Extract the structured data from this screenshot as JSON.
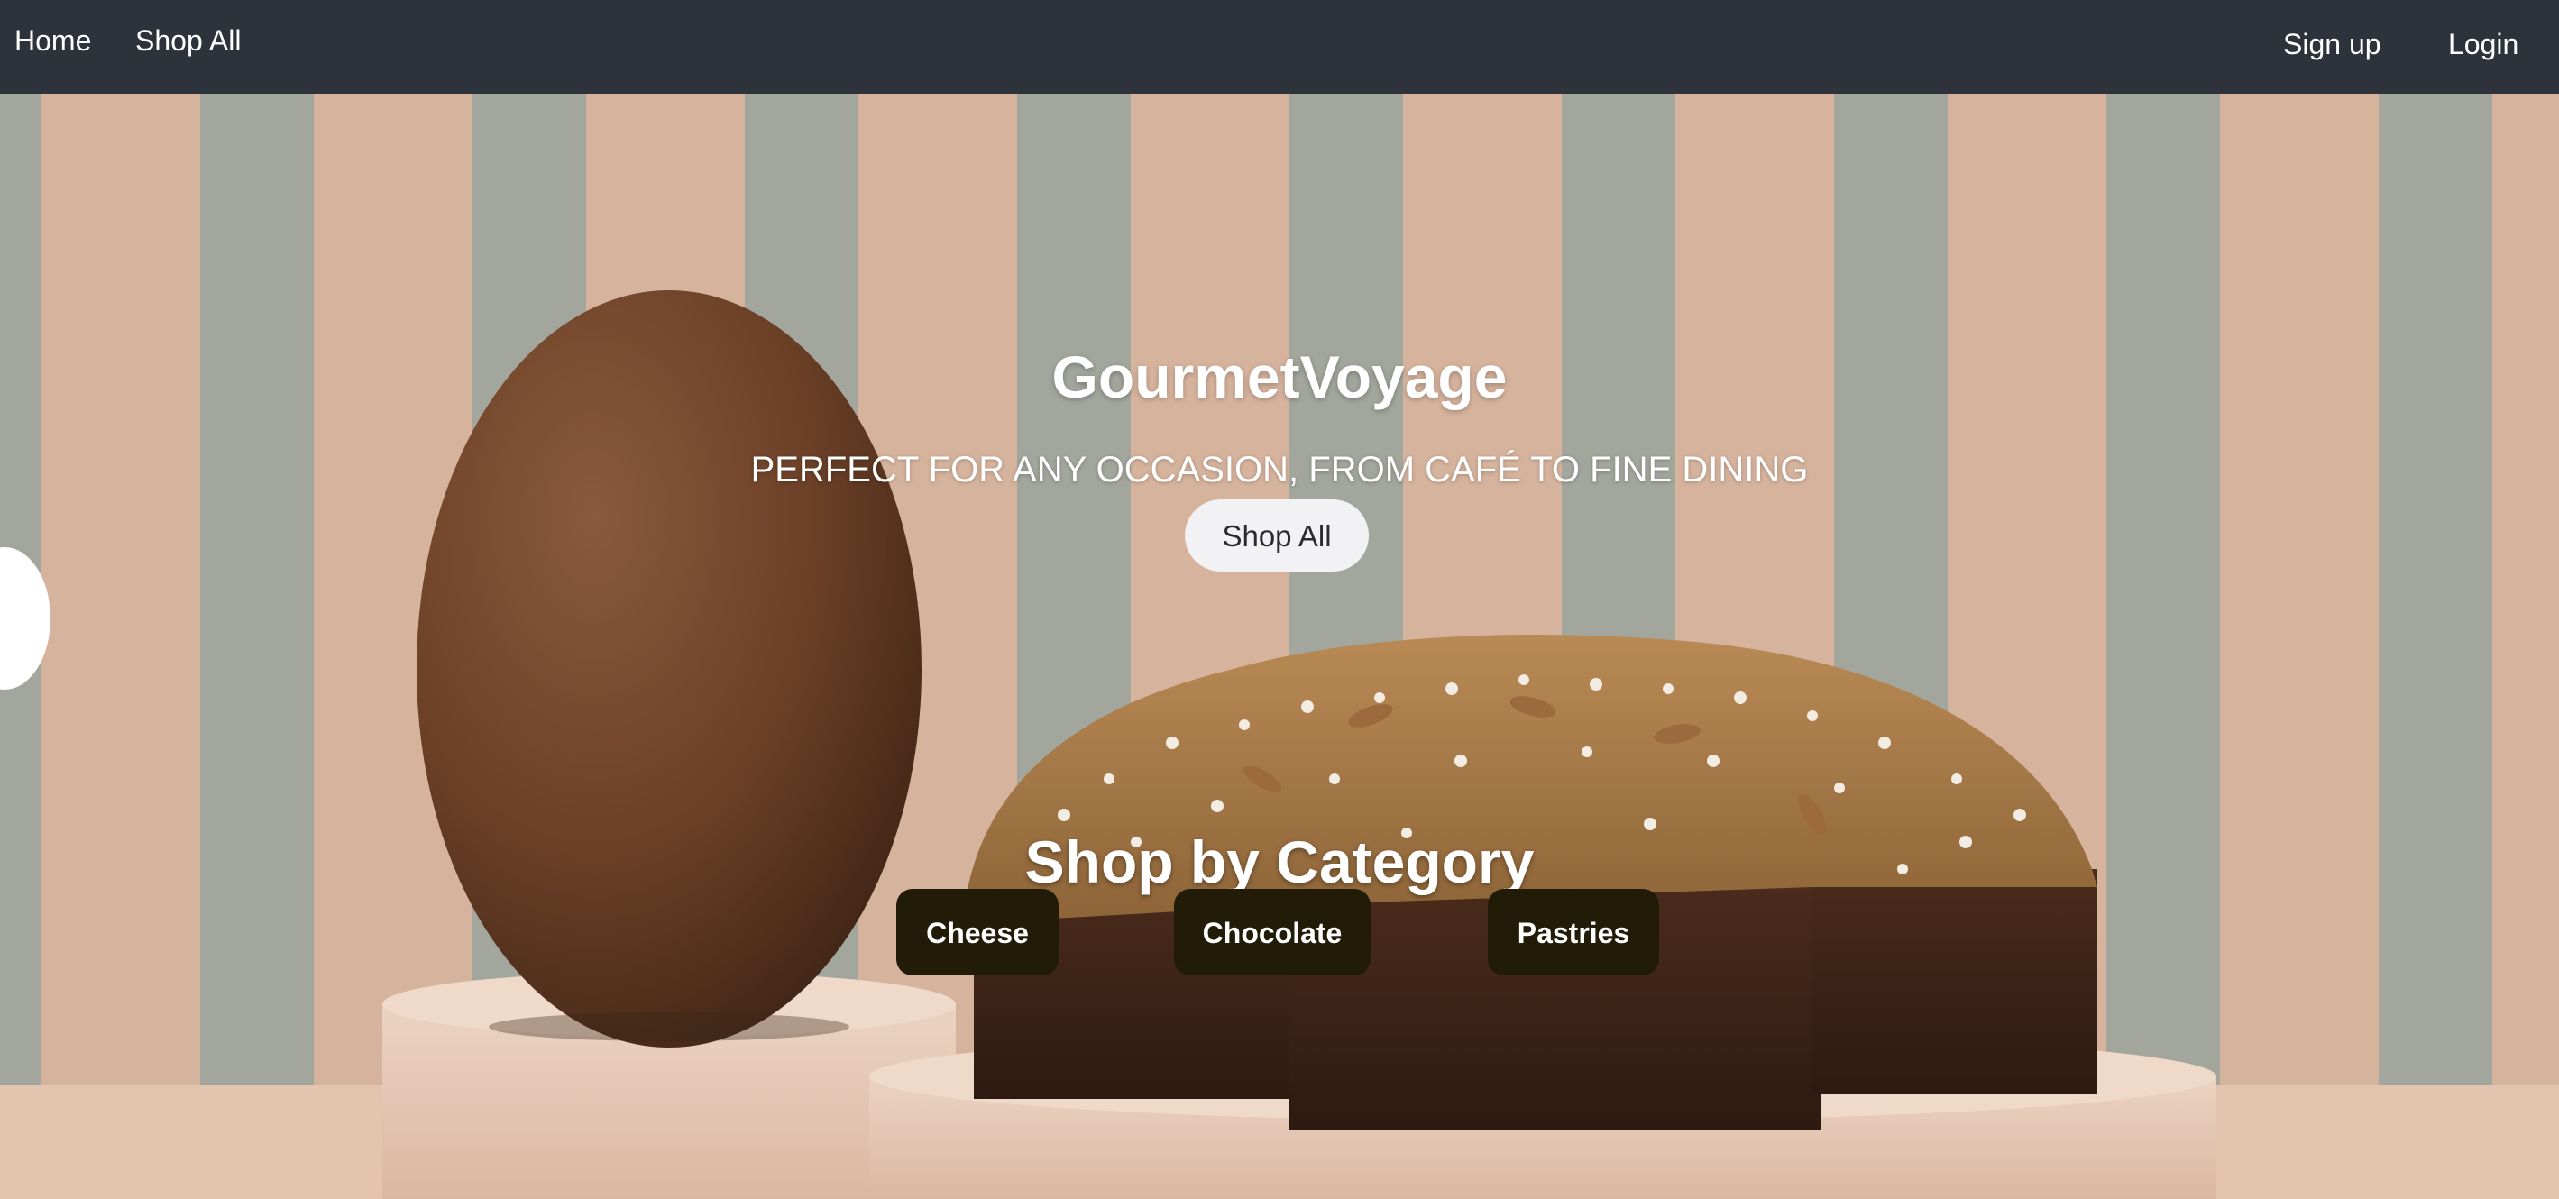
{
  "navbar": {
    "home": "Home",
    "shop_all": "Shop All",
    "sign_up": "Sign up",
    "login": "Login"
  },
  "hero": {
    "title": "GourmetVoyage",
    "subtitle": "PERFECT FOR ANY OCCASION, FROM CAFÉ TO FINE DINING",
    "button": "Shop All"
  },
  "categories": {
    "title": "Shop by Category",
    "items": [
      {
        "label": "Cheese"
      },
      {
        "label": "Chocolate"
      },
      {
        "label": "Pastries"
      }
    ]
  },
  "colors": {
    "navbar_bg": "#2e323a",
    "category_button_bg": "#211b08",
    "hero_button_bg": "#f2f2f4"
  }
}
